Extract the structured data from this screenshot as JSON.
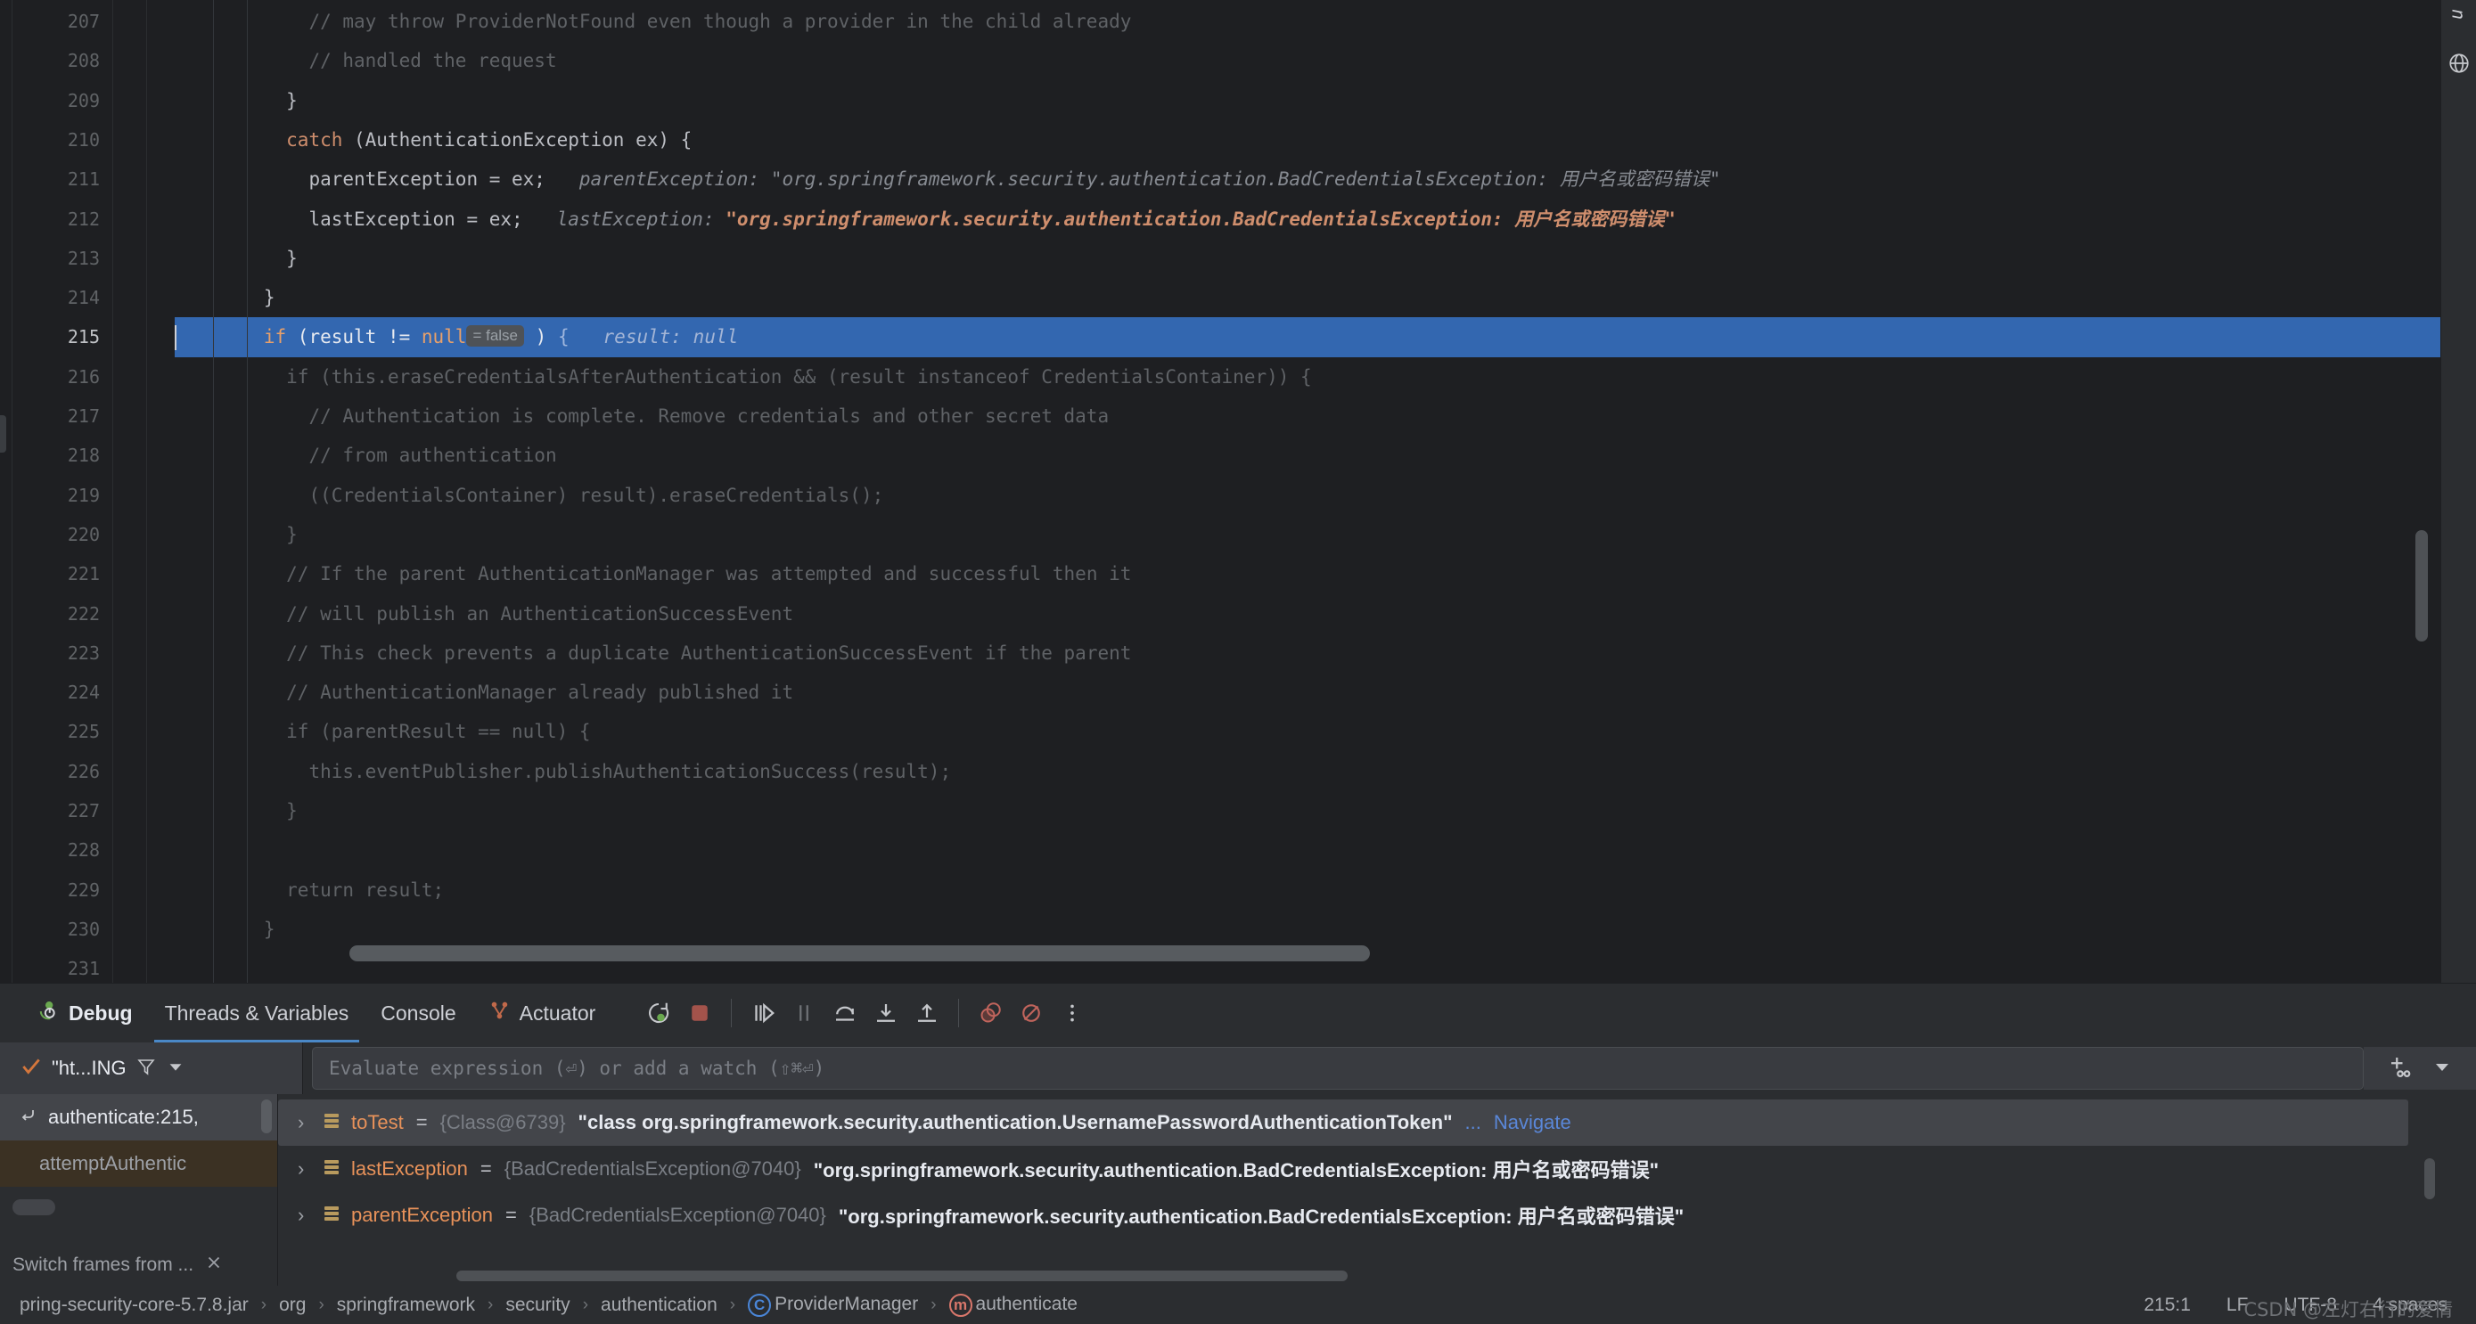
{
  "editor": {
    "first_line": 207,
    "active_line": 215,
    "lines": [
      {
        "n": 207,
        "indent": 10,
        "segs": [
          {
            "t": "// may throw ProviderNotFound even though a provider in the child already",
            "c": "dim"
          }
        ]
      },
      {
        "n": 208,
        "indent": 10,
        "segs": [
          {
            "t": "// handled the request",
            "c": "dim"
          }
        ]
      },
      {
        "n": 209,
        "indent": 8,
        "segs": [
          {
            "t": "}",
            "c": "txt"
          }
        ]
      },
      {
        "n": 210,
        "indent": 8,
        "segs": [
          {
            "t": "catch ",
            "c": "kw"
          },
          {
            "t": "(AuthenticationException ex) {",
            "c": "txt"
          }
        ]
      },
      {
        "n": 211,
        "indent": 10,
        "segs": [
          {
            "t": "parentException = ex;",
            "c": "txt"
          },
          {
            "t": "   parentException: ",
            "c": "hint"
          },
          {
            "t": "\"org.springframework.security.authentication.BadCredentialsException: 用户名或密码错误\"",
            "c": "hint"
          }
        ]
      },
      {
        "n": 212,
        "indent": 10,
        "segs": [
          {
            "t": "lastException = ex;",
            "c": "txt"
          },
          {
            "t": "   lastException: ",
            "c": "hint"
          },
          {
            "t": "\"org.springframework.security.authentication.BadCredentialsException: 用户名或密码错误\"",
            "c": "strhint"
          }
        ]
      },
      {
        "n": 213,
        "indent": 8,
        "segs": [
          {
            "t": "}",
            "c": "txt"
          }
        ]
      },
      {
        "n": 214,
        "indent": 6,
        "segs": [
          {
            "t": "}",
            "c": "txt"
          }
        ]
      },
      {
        "n": 215,
        "indent": 6,
        "active": true,
        "segs": [
          {
            "t": "if ",
            "c": "hlkw"
          },
          {
            "t": "(result != ",
            "c": "hltxt"
          },
          {
            "t": "null",
            "c": "hlkw"
          },
          {
            "t": "= false",
            "c": "inlay"
          },
          {
            "t": " ) ",
            "c": "hltxt"
          },
          {
            "t": "{",
            "c": "hlbrace"
          },
          {
            "t": "   result: null",
            "c": "hinthl"
          }
        ]
      },
      {
        "n": 216,
        "indent": 8,
        "dim": true,
        "segs": [
          {
            "t": "if (this.eraseCredentialsAfterAuthentication && (result instanceof CredentialsContainer)) {",
            "c": "dim"
          }
        ]
      },
      {
        "n": 217,
        "indent": 10,
        "dim": true,
        "segs": [
          {
            "t": "// Authentication is complete. Remove credentials and other secret data",
            "c": "dim"
          }
        ]
      },
      {
        "n": 218,
        "indent": 10,
        "dim": true,
        "segs": [
          {
            "t": "// from authentication",
            "c": "dim"
          }
        ]
      },
      {
        "n": 219,
        "indent": 10,
        "dim": true,
        "segs": [
          {
            "t": "((CredentialsContainer) result).eraseCredentials();",
            "c": "dim"
          }
        ]
      },
      {
        "n": 220,
        "indent": 8,
        "dim": true,
        "segs": [
          {
            "t": "}",
            "c": "dim"
          }
        ]
      },
      {
        "n": 221,
        "indent": 8,
        "dim": true,
        "segs": [
          {
            "t": "// If the parent AuthenticationManager was attempted and successful then it",
            "c": "dim"
          }
        ]
      },
      {
        "n": 222,
        "indent": 8,
        "dim": true,
        "segs": [
          {
            "t": "// will publish an AuthenticationSuccessEvent",
            "c": "dim"
          }
        ]
      },
      {
        "n": 223,
        "indent": 8,
        "dim": true,
        "segs": [
          {
            "t": "// This check prevents a duplicate AuthenticationSuccessEvent if the parent",
            "c": "dim"
          }
        ]
      },
      {
        "n": 224,
        "indent": 8,
        "dim": true,
        "segs": [
          {
            "t": "// AuthenticationManager already published it",
            "c": "dim"
          }
        ]
      },
      {
        "n": 225,
        "indent": 8,
        "dim": true,
        "segs": [
          {
            "t": "if (parentResult == null) {",
            "c": "dim"
          }
        ]
      },
      {
        "n": 226,
        "indent": 10,
        "dim": true,
        "segs": [
          {
            "t": "this.eventPublisher.publishAuthenticationSuccess(result);",
            "c": "dim"
          }
        ]
      },
      {
        "n": 227,
        "indent": 8,
        "dim": true,
        "segs": [
          {
            "t": "}",
            "c": "dim"
          }
        ]
      },
      {
        "n": 228,
        "indent": 0,
        "dim": true,
        "segs": [
          {
            "t": "",
            "c": "dim"
          }
        ]
      },
      {
        "n": 229,
        "indent": 8,
        "dim": true,
        "segs": [
          {
            "t": "return result;",
            "c": "dim"
          }
        ]
      },
      {
        "n": 230,
        "indent": 6,
        "dim": true,
        "segs": [
          {
            "t": "}",
            "c": "dim"
          }
        ]
      },
      {
        "n": 231,
        "indent": 0,
        "dim": true,
        "segs": [
          {
            "t": "",
            "c": "dim"
          }
        ]
      }
    ]
  },
  "right_strip": {
    "vtab_label": "n",
    "globe_icon": "globe-icon"
  },
  "debug": {
    "title": "Debug",
    "tabs": [
      {
        "label": "Threads & Variables",
        "selected": true
      },
      {
        "label": "Console",
        "selected": false
      },
      {
        "label": "Actuator",
        "selected": false,
        "icon": "actuator-icon"
      }
    ],
    "toolbar": [
      {
        "name": "rerun-debug-icon",
        "title": "Rerun"
      },
      {
        "name": "stop-icon",
        "title": "Stop"
      },
      {
        "name": "resume-icon",
        "title": "Resume Program"
      },
      {
        "name": "pause-icon",
        "title": "Pause Program"
      },
      {
        "name": "step-over-icon",
        "title": "Step Over"
      },
      {
        "name": "step-into-icon",
        "title": "Step Into"
      },
      {
        "name": "step-out-icon",
        "title": "Step Out"
      },
      {
        "name": "view-breakpoints-icon",
        "title": "View Breakpoints"
      },
      {
        "name": "mute-breakpoints-icon",
        "title": "Mute Breakpoints"
      },
      {
        "name": "more-options-icon",
        "title": "More"
      }
    ],
    "eval": {
      "thread_label": "\"ht...ING",
      "filter_icon": "filter-icon",
      "dropdown_icon": "chevron-down-icon",
      "placeholder": "Evaluate expression (⏎) or add a watch (⇧⌘⏎)",
      "add_watch_icon": "add-watch-icon",
      "settings_icon": "chevron-down-icon"
    },
    "frames": {
      "items": [
        {
          "label": "authenticate:215,",
          "selected": true,
          "icon": "frame-return-icon"
        },
        {
          "label": "attemptAuthentic",
          "selected": false,
          "library": true
        }
      ],
      "switch_text": "Switch frames from ...",
      "close_icon": "close-icon"
    },
    "variables": [
      {
        "selected": true,
        "chevron": "›",
        "name": "toTest",
        "eq": "=",
        "type": "{Class@6739}",
        "value": "\"class org.springframework.security.authentication.UsernamePasswordAuthenticationToken\"",
        "ellipsis": "...",
        "link": "Navigate"
      },
      {
        "selected": false,
        "chevron": "›",
        "name": "lastException",
        "eq": "=",
        "type": "{BadCredentialsException@7040}",
        "value": "\"org.springframework.security.authentication.BadCredentialsException: 用户名或密码错误\"",
        "ellipsis": "",
        "link": ""
      },
      {
        "selected": false,
        "chevron": "›",
        "name": "parentException",
        "eq": "=",
        "type": "{BadCredentialsException@7040}",
        "value": "\"org.springframework.security.authentication.BadCredentialsException: 用户名或密码错误\"",
        "ellipsis": "",
        "link": ""
      }
    ]
  },
  "status": {
    "breadcrumbs": [
      {
        "label": "pring-security-core-5.7.8.jar",
        "icon": ""
      },
      {
        "label": "org",
        "icon": ""
      },
      {
        "label": "springframework",
        "icon": ""
      },
      {
        "label": "security",
        "icon": ""
      },
      {
        "label": "authentication",
        "icon": ""
      },
      {
        "label": "ProviderManager",
        "icon": "class-icon"
      },
      {
        "label": "authenticate",
        "icon": "method-icon"
      }
    ],
    "separator": "›",
    "caret_position": "215:1",
    "line_separator": "LF",
    "encoding": "UTF-8",
    "indent": "4 spaces",
    "watermark": "CSDN @左灯右行的爱情"
  },
  "colors": {
    "editor_bg": "#1e1f22",
    "panel_bg": "#2b2d30",
    "highlight_line": "#3367b0",
    "keyword": "#cf8e6d",
    "accent_link": "#5a87d8",
    "variable_name": "#e8925a"
  }
}
